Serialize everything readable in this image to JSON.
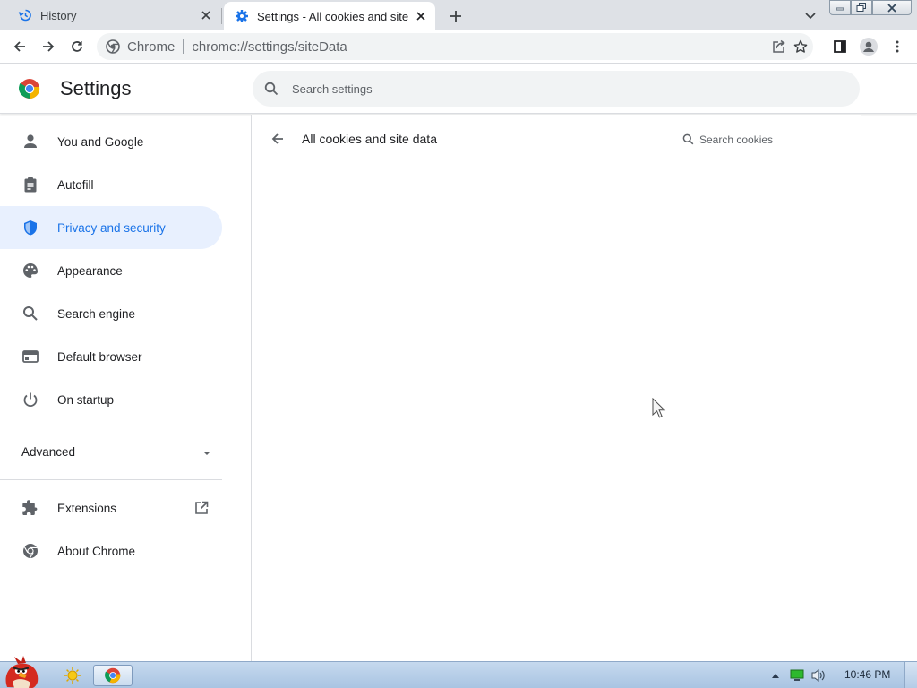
{
  "browser": {
    "tabs": [
      {
        "title": "History",
        "icon": "history-icon",
        "active": false
      },
      {
        "title": "Settings - All cookies and site data",
        "icon": "gear-icon",
        "active": true
      }
    ],
    "omnibox": {
      "chip": "Chrome",
      "url": "chrome://settings/siteData"
    }
  },
  "settings": {
    "title": "Settings",
    "search_placeholder": "Search settings",
    "sidebar": {
      "items": [
        {
          "label": "You and Google",
          "icon": "person-icon"
        },
        {
          "label": "Autofill",
          "icon": "clipboard-icon"
        },
        {
          "label": "Privacy and security",
          "icon": "shield-icon",
          "selected": true
        },
        {
          "label": "Appearance",
          "icon": "palette-icon"
        },
        {
          "label": "Search engine",
          "icon": "search-icon"
        },
        {
          "label": "Default browser",
          "icon": "browser-window-icon"
        },
        {
          "label": "On startup",
          "icon": "power-icon"
        }
      ],
      "advanced_label": "Advanced",
      "extensions_label": "Extensions",
      "about_label": "About Chrome"
    },
    "page": {
      "title": "All cookies and site data",
      "search_placeholder": "Search cookies"
    }
  },
  "taskbar": {
    "clock": "10:46 PM"
  },
  "colors": {
    "accent": "#1a73e8",
    "selected_bg": "#e8f0fe",
    "icon_gray": "#5f6368"
  }
}
